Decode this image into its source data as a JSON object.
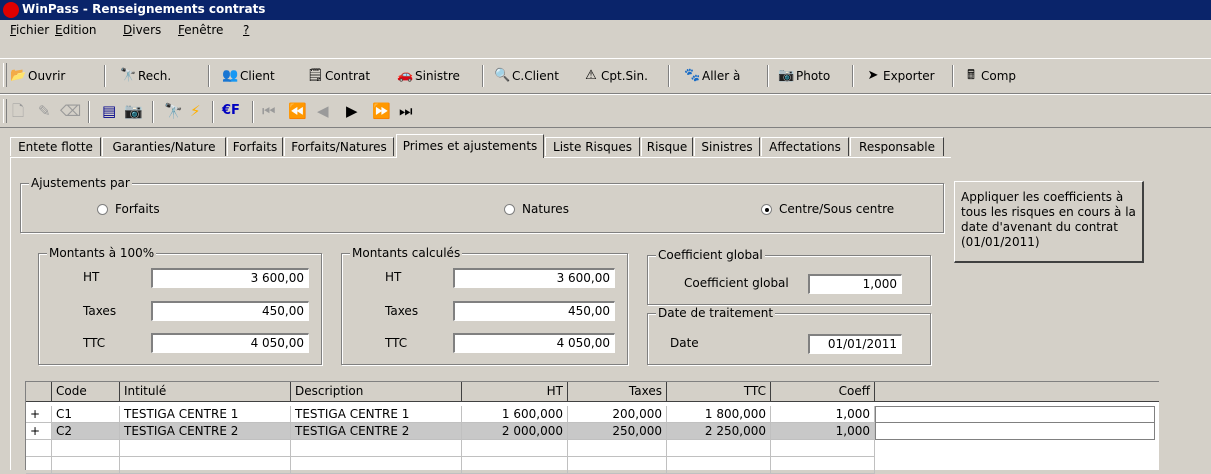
{
  "window": {
    "title": "WinPass - Renseignements contrats"
  },
  "menu": [
    {
      "u": "F",
      "rest": "ichier"
    },
    {
      "u": "E",
      "rest": "dition"
    },
    {
      "u": "D",
      "rest": "ivers"
    },
    {
      "u": "F",
      "rest": "enêtre"
    },
    {
      "u": "?",
      "rest": ""
    }
  ],
  "toolbar1": {
    "ouvrir": "Ouvrir",
    "rech": "Rech.",
    "client": "Client",
    "contrat": "Contrat",
    "sinistre": "Sinistre",
    "cclient": "C.Client",
    "cptsin": "Cpt.Sin.",
    "allera": "Aller à",
    "photo": "Photo",
    "exporter": "Exporter",
    "comp": "Comp"
  },
  "toolbar2": {
    "euro_label": "€F"
  },
  "tabs": [
    "Entete flotte",
    "Garanties/Nature",
    "Forfaits",
    "Forfaits/Natures",
    "Primes et ajustements",
    "Liste Risques",
    "Risque",
    "Sinistres",
    "Affectations",
    "Responsable"
  ],
  "ajustements": {
    "title": "Ajustements par",
    "options": [
      "Forfaits",
      "Natures",
      "Centre/Sous centre"
    ],
    "selected": "Centre/Sous centre"
  },
  "apply_button": "Appliquer les coefficients à tous les risques en cours à la date d'avenant du contrat (01/01/2011)",
  "montants100": {
    "title": "Montants à 100%",
    "rows": [
      {
        "label": "HT",
        "value": "3 600,00"
      },
      {
        "label": "Taxes",
        "value": "450,00"
      },
      {
        "label": "TTC",
        "value": "4 050,00"
      }
    ]
  },
  "montantsCalc": {
    "title": "Montants calculés",
    "rows": [
      {
        "label": "HT",
        "value": "3 600,00"
      },
      {
        "label": "Taxes",
        "value": "450,00"
      },
      {
        "label": "TTC",
        "value": "4 050,00"
      }
    ]
  },
  "coeff": {
    "title": "Coefficient global",
    "label": "Coefficient global",
    "value": "1,000"
  },
  "datetrt": {
    "title": "Date de traitement",
    "label": "Date",
    "value": "01/01/2011"
  },
  "grid": {
    "headers": [
      "Code",
      "Intitulé",
      "Description",
      "HT",
      "Taxes",
      "TTC",
      "Coeff"
    ],
    "rows": [
      {
        "exp": "+",
        "code": "C1",
        "intitule": "TESTIGA CENTRE 1",
        "description": "TESTIGA CENTRE 1",
        "ht": "1 600,000",
        "taxes": "200,000",
        "ttc": "1 800,000",
        "coeff": "1,000"
      },
      {
        "exp": "+",
        "code": "C2",
        "intitule": "TESTIGA CENTRE 2",
        "description": "TESTIGA CENTRE 2",
        "ht": "2 000,000",
        "taxes": "250,000",
        "ttc": "2 250,000",
        "coeff": "1,000"
      }
    ]
  },
  "colors": {
    "titlebar": "#0a246a",
    "face": "#d4d0c8",
    "selected_row": "#c8c8c8"
  }
}
